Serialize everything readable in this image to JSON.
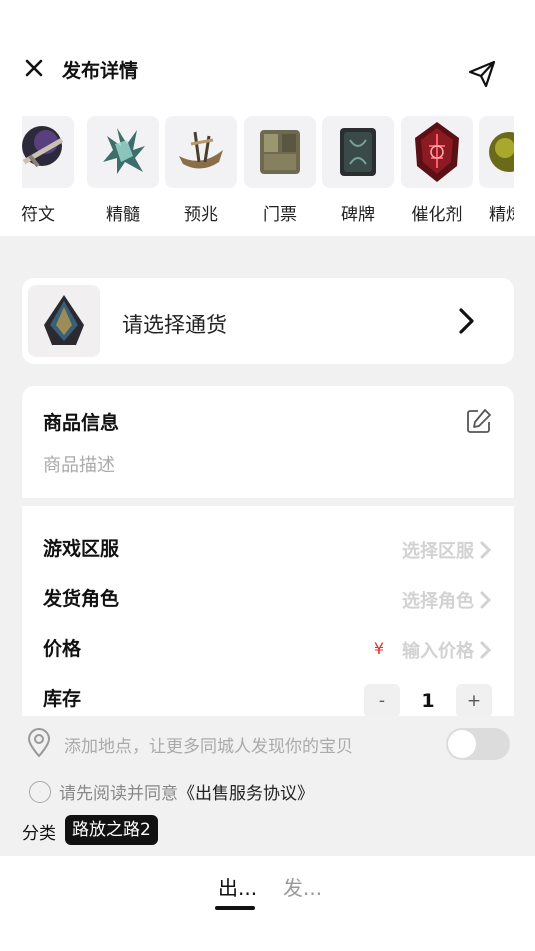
{
  "header": {
    "title": "发布详情",
    "close_icon": "close-icon",
    "send_icon": "send-icon"
  },
  "categories": [
    {
      "label": "符文",
      "icon": "rune-icon"
    },
    {
      "label": "精髓",
      "icon": "essence-icon"
    },
    {
      "label": "预兆",
      "icon": "omen-icon"
    },
    {
      "label": "门票",
      "icon": "ticket-icon"
    },
    {
      "label": "碑牌",
      "icon": "tablet-icon"
    },
    {
      "label": "催化剂",
      "icon": "catalyst-icon"
    },
    {
      "label": "精炼",
      "icon": "refine-icon"
    }
  ],
  "currency": {
    "label": "请选择通货",
    "icon": "currency-icon"
  },
  "product_info": {
    "title": "商品信息",
    "description_placeholder": "商品描述",
    "edit_icon": "edit-icon"
  },
  "form": {
    "server": {
      "label": "游戏区服",
      "value": "选择区服"
    },
    "role": {
      "label": "发货角色",
      "value": "选择角色"
    },
    "price": {
      "label": "价格",
      "currency_symbol": "¥",
      "value": "输入价格"
    },
    "stock": {
      "label": "库存",
      "minus": "-",
      "quantity": "1",
      "plus": "+"
    }
  },
  "location": {
    "text": "添加地点，让更多同城人发现你的宝贝",
    "enabled": false
  },
  "agreement": {
    "prefix": "请先阅读并同意",
    "link": "《出售服务协议》"
  },
  "category_tag": {
    "label": "分类",
    "value": "路放之路2"
  },
  "bottom_tabs": {
    "active": "出...",
    "inactive": "发..."
  },
  "colors": {
    "background": "#f1f1f1",
    "accent": "#111111",
    "price_symbol": "#e0302a",
    "placeholder": "#aaaaaa"
  }
}
